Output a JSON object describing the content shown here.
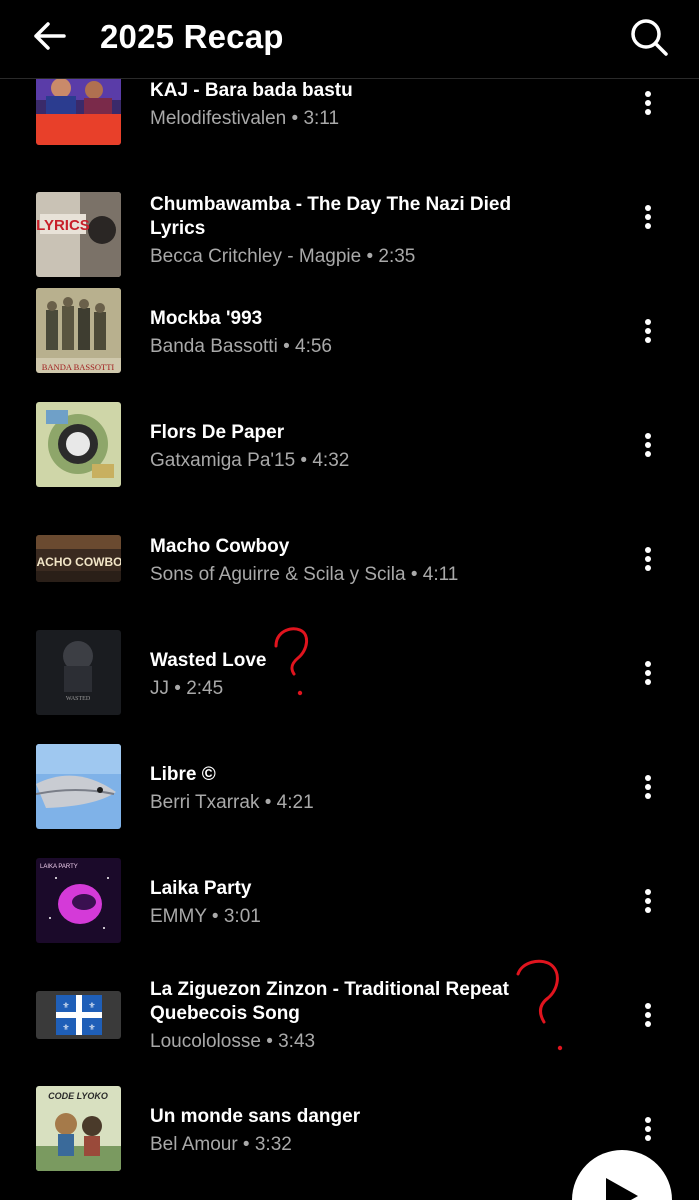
{
  "header": {
    "title": "2025 Recap",
    "back_icon": "arrow-left-icon",
    "search_icon": "search-icon"
  },
  "tracks": [
    {
      "title": "KAJ - Bara bada bastu",
      "subtitle": "Melodifestivalen • 3:11"
    },
    {
      "title": "Chumbawamba - The Day The Nazi Died Lyrics",
      "subtitle": "Becca Critchley - Magpie • 2:35"
    },
    {
      "title": "Mockba '993",
      "subtitle": "Banda Bassotti • 4:56"
    },
    {
      "title": "Flors De Paper",
      "subtitle": "Gatxamiga Pa'15 • 4:32"
    },
    {
      "title": "Macho Cowboy",
      "subtitle": "Sons of Aguirre & Scila y Scila • 4:11"
    },
    {
      "title": "Wasted Love",
      "subtitle": "JJ • 2:45"
    },
    {
      "title": "Libre ©",
      "subtitle": "Berri Txarrak • 4:21"
    },
    {
      "title": "Laika Party",
      "subtitle": "EMMY • 3:01"
    },
    {
      "title": "La Ziguezon Zinzon - Traditional Repeat Quebecois Song",
      "subtitle": "Loucololosse • 3:43"
    },
    {
      "title": "Un monde sans danger",
      "subtitle": "Bel Amour • 3:32"
    }
  ],
  "thumb_text": {
    "lyrics": "LYRICS",
    "banda": "BANDA BASSOTTI",
    "macho": "MACHO COWBOY",
    "wasted": "WASTED",
    "laika": "LAIKA PARTY",
    "code_lyoko": "CODE LYOKO"
  },
  "annotations": {
    "mark": "?",
    "color": "#e0141e"
  },
  "play_icon": "play-icon"
}
